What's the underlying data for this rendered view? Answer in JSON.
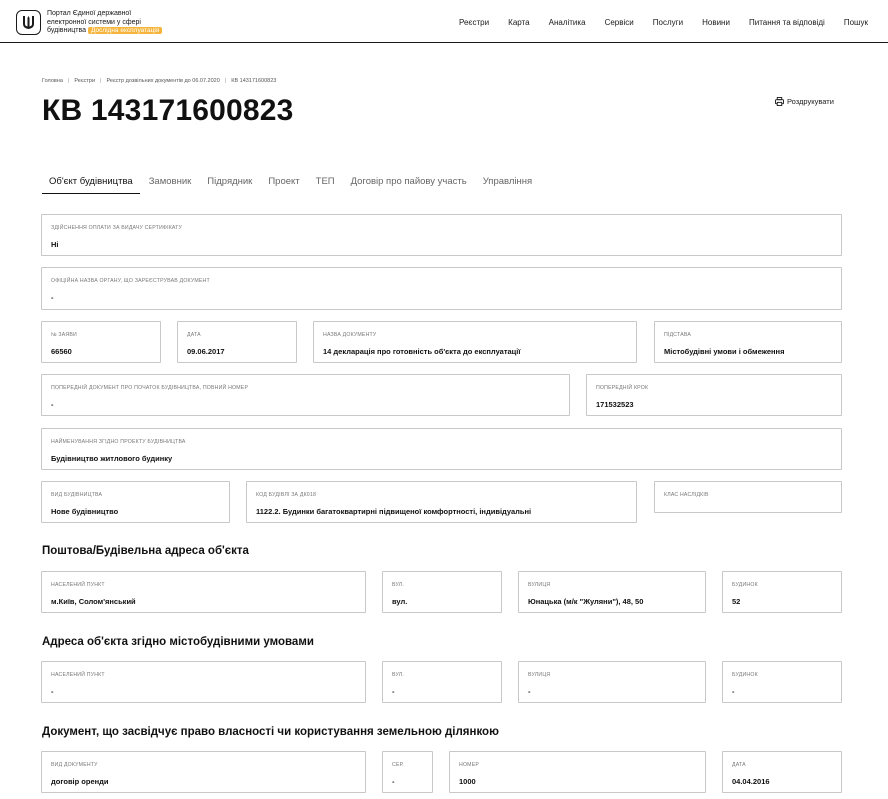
{
  "header": {
    "portal_line1": "Портал Єдиної державної",
    "portal_line2": "електронної системи у сфері",
    "portal_line3": "будівництва",
    "badge": "Дослідна експлуатація",
    "nav": [
      "Реєстри",
      "Карта",
      "Аналітика",
      "Сервіси",
      "Послуги",
      "Новини",
      "Питання та відповіді",
      "Пошук"
    ]
  },
  "breadcrumb": [
    "Головна",
    "Реєстри",
    "Реєстр дозвільних документів до 06.07.2020",
    "КВ 143171600823"
  ],
  "page_title": "КВ 143171600823",
  "print_label": "Роздрукувати",
  "tabs": [
    "Об'єкт будівництва",
    "Замовник",
    "Підрядник",
    "Проект",
    "ТЕП",
    "Договір про пайову участь",
    "Управління"
  ],
  "fields": {
    "payment": {
      "label": "Здійснення оплати за видачу сертифікату",
      "value": "Ні"
    },
    "organ": {
      "label": "Офіційна назва органу, що зареєстрував документ",
      "value": "-"
    },
    "app_no": {
      "label": "№ заяви",
      "value": "66560"
    },
    "date": {
      "label": "Дата",
      "value": "09.06.2017"
    },
    "doc_name": {
      "label": "Назва документу",
      "value": "14 декларація про готовність об'єкта до експлуатації"
    },
    "basis": {
      "label": "Підстава",
      "value": "Містобудівні умови і обмеження"
    },
    "prev_doc": {
      "label": "Попередній документ про початок будівництва, повний номер",
      "value": "-"
    },
    "prev_step": {
      "label": "Попередній крок",
      "value": "171532523"
    },
    "project_name": {
      "label": "Найменування згідно проекту будівництва",
      "value": "Будівництво житлового будинку"
    },
    "build_type": {
      "label": "Вид будівництва",
      "value": "Нове будівництво"
    },
    "dk018": {
      "label": "Код будівлі за ДК018",
      "value": "1122.2. Будинки багатоквартирні підвищеної комфортності, індивідуальні"
    },
    "consequence": {
      "label": "Клас наслідків",
      "value": ""
    }
  },
  "sections": {
    "postal": {
      "title": "Поштова/Будівельна адреса об'єкта",
      "settlement": {
        "label": "Населений пункт",
        "value": "м.Київ, Солом'янський"
      },
      "street_type": {
        "label": "Вул.",
        "value": "вул."
      },
      "street": {
        "label": "Вулиця",
        "value": "Юнацька (м/к \"Жуляни\"), 48, 50"
      },
      "building": {
        "label": "Будинок",
        "value": "52"
      }
    },
    "urban": {
      "title": "Адреса об'єкта згідно містобудівними умовами",
      "settlement": {
        "label": "Населений пункт",
        "value": "-"
      },
      "street_type": {
        "label": "Вул.",
        "value": "-"
      },
      "street": {
        "label": "Вулиця",
        "value": "-"
      },
      "building": {
        "label": "Будинок",
        "value": "-"
      }
    },
    "land": {
      "title": "Документ, що засвідчує право власності чи користування земельною ділянкою",
      "doc_type": {
        "label": "Вид документу",
        "value": "договір оренди"
      },
      "series": {
        "label": "Сер.",
        "value": "-"
      },
      "number": {
        "label": "Номер",
        "value": "1000"
      },
      "date": {
        "label": "Дата",
        "value": "04.04.2016"
      }
    }
  }
}
